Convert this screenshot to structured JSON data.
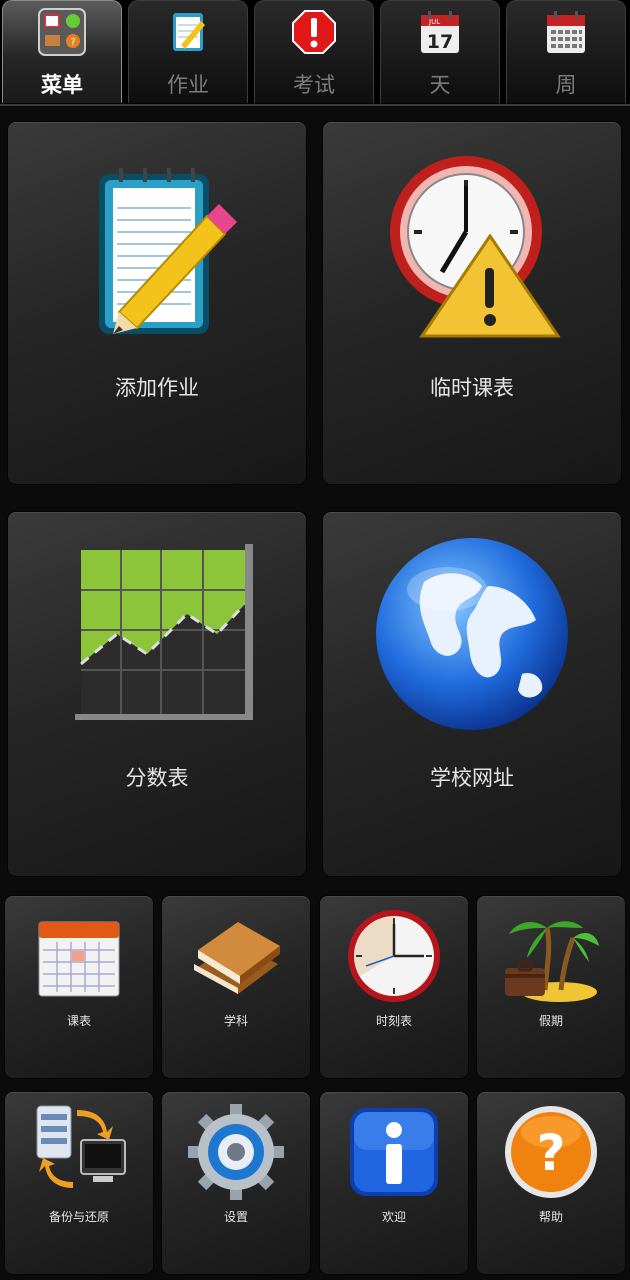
{
  "tabs": [
    {
      "label": "菜单",
      "icon": "menu-icon",
      "active": true
    },
    {
      "label": "作业",
      "icon": "notepad-icon",
      "active": false
    },
    {
      "label": "考试",
      "icon": "exam-alert-icon",
      "active": false
    },
    {
      "label": "天",
      "icon": "day-calendar-icon",
      "active": false,
      "calendar_month": "JUL",
      "calendar_day": "17"
    },
    {
      "label": "周",
      "icon": "week-calendar-icon",
      "active": false
    }
  ],
  "big_tiles": [
    {
      "label": "添加作业",
      "icon": "notepad-pencil-icon"
    },
    {
      "label": "临时课表",
      "icon": "clock-warning-icon"
    },
    {
      "label": "分数表",
      "icon": "score-chart-icon"
    },
    {
      "label": "学校网址",
      "icon": "globe-icon"
    }
  ],
  "small_tiles": [
    {
      "label": "课表",
      "icon": "timetable-calendar-icon"
    },
    {
      "label": "学科",
      "icon": "books-icon"
    },
    {
      "label": "时刻表",
      "icon": "clock-icon"
    },
    {
      "label": "假期",
      "icon": "palm-island-icon"
    },
    {
      "label": "备份与还原",
      "icon": "backup-restore-icon"
    },
    {
      "label": "设置",
      "icon": "gear-icon"
    },
    {
      "label": "欢迎",
      "icon": "info-icon"
    },
    {
      "label": "帮助",
      "icon": "help-icon"
    }
  ],
  "colors": {
    "background": "#0b0b0b",
    "tab_active_text": "#ffffff",
    "tab_inactive_text": "#7c7c7c",
    "tile_label": "#e6e6e6"
  }
}
